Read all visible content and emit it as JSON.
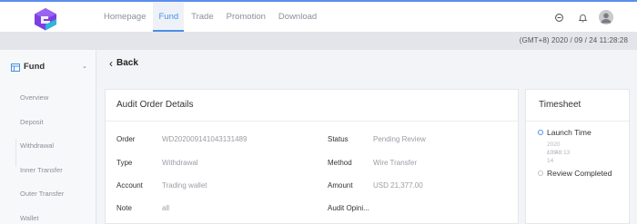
{
  "brand": {
    "accent": "#4a8fe7",
    "logo_color": "#7b3fe4"
  },
  "nav": {
    "items": [
      "Homepage",
      "Fund",
      "Trade",
      "Promotion",
      "Download"
    ],
    "active": "Fund"
  },
  "top_icons": [
    "settings-icon",
    "bell-icon",
    "avatar"
  ],
  "clock": "(GMT+8) 2020 / 09 / 24 11:28:28",
  "sidebar": {
    "title": "Fund",
    "items": [
      "Overview",
      "Deposit",
      "Withdrawal",
      "Inner Transfer",
      "Outer Transfer",
      "Wallet"
    ]
  },
  "back": {
    "label": "Back"
  },
  "details": {
    "title": "Audit Order Details",
    "order_label": "Order",
    "order_value": "WD202009141043131489",
    "type_label": "Type",
    "type_value": "Withdrawal",
    "account_label": "Account",
    "account_value": "Trading wallet",
    "note_label": "Note",
    "note_value": "all",
    "status_label": "Status",
    "status_value": "Pending Review",
    "method_label": "Method",
    "method_value": "Wire Transfer",
    "amount_label": "Amount",
    "amount_value": "USD 21,377.00",
    "audit_label": "Audit Opini..."
  },
  "timesheet": {
    "title": "Timesheet",
    "events": [
      {
        "title": "Launch Time",
        "date": "2020 / 09 / 14",
        "time": "10:43:13",
        "active": true
      },
      {
        "title": "Review Completed",
        "active": false
      }
    ]
  }
}
